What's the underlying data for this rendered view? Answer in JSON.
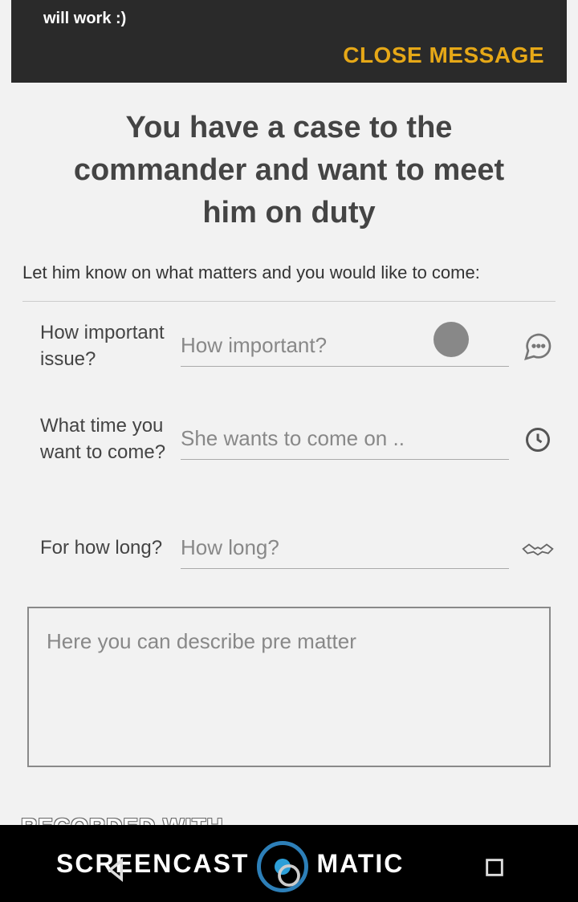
{
  "header": {
    "message_fragment": "will work :)",
    "close_label": "CLOSE MESSAGE"
  },
  "page": {
    "title": "You have a case to the commander and want to meet him on duty",
    "subtitle": "Let him know on what matters and you would like to come:"
  },
  "fields": {
    "importance": {
      "label": "How important issue?",
      "placeholder": "How important?"
    },
    "time": {
      "label": "What time you want to come?",
      "placeholder": "She wants to come on .."
    },
    "duration": {
      "label": "For how long?",
      "placeholder": "How long?"
    },
    "description": {
      "placeholder": "Here you can describe pre matter"
    }
  },
  "watermark": {
    "line1": "RECORDED WITH",
    "brand_left": "SCREENCAST",
    "brand_right": "MATIC"
  },
  "colors": {
    "accent": "#e6a817",
    "dark_header": "#2a2a2a",
    "nav_bg": "#000000",
    "brand_blue": "#2d7fb8"
  }
}
